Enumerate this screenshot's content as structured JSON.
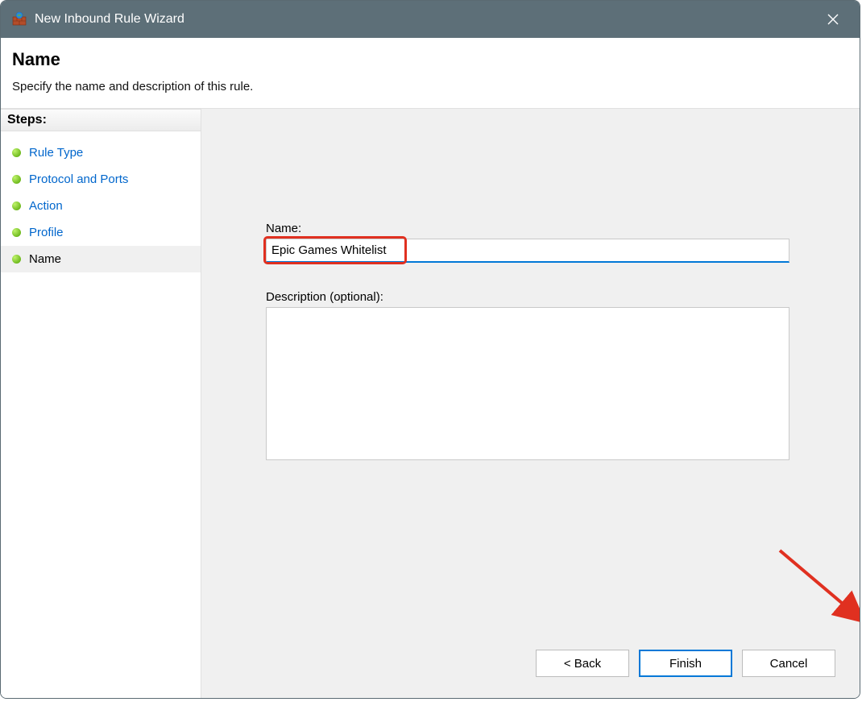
{
  "window": {
    "title": "New Inbound Rule Wizard"
  },
  "header": {
    "title": "Name",
    "subtitle": "Specify the name and description of this rule."
  },
  "sidebar": {
    "heading": "Steps:",
    "items": [
      {
        "label": "Rule Type",
        "current": false
      },
      {
        "label": "Protocol and Ports",
        "current": false
      },
      {
        "label": "Action",
        "current": false
      },
      {
        "label": "Profile",
        "current": false
      },
      {
        "label": "Name",
        "current": true
      }
    ]
  },
  "form": {
    "name_label": "Name:",
    "name_value": "Epic Games Whitelist",
    "description_label": "Description (optional):",
    "description_value": ""
  },
  "buttons": {
    "back": "< Back",
    "finish": "Finish",
    "cancel": "Cancel"
  }
}
